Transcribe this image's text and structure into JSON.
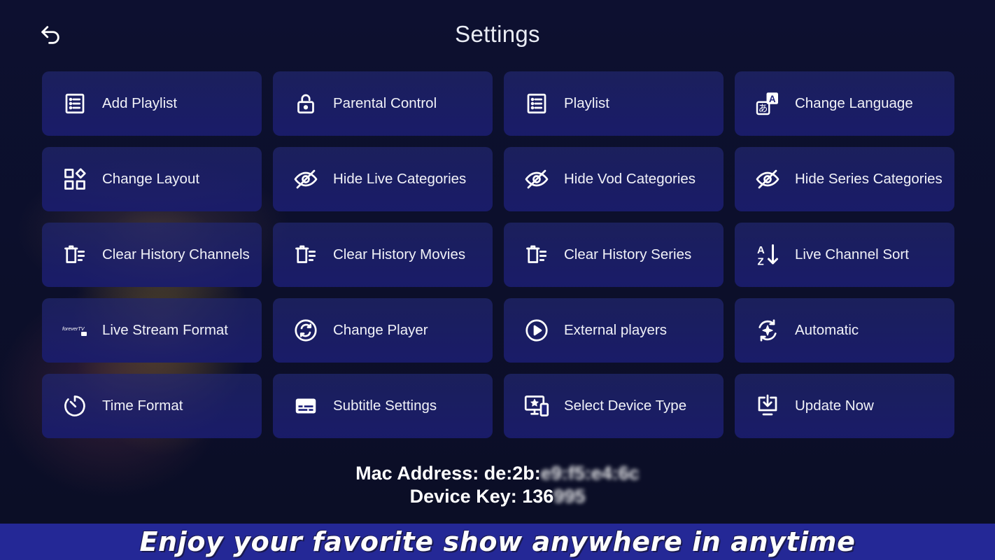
{
  "header": {
    "title": "Settings"
  },
  "tiles": [
    {
      "label": "Add Playlist",
      "icon": "list-icon"
    },
    {
      "label": "Parental Control",
      "icon": "lock-icon"
    },
    {
      "label": "Playlist",
      "icon": "list-icon"
    },
    {
      "label": "Change Language",
      "icon": "translate-icon"
    },
    {
      "label": "Change Layout",
      "icon": "layout-icon"
    },
    {
      "label": "Hide Live Categories",
      "icon": "eye-off-icon"
    },
    {
      "label": "Hide Vod Categories",
      "icon": "eye-off-icon"
    },
    {
      "label": "Hide Series Categories",
      "icon": "eye-off-icon"
    },
    {
      "label": "Clear History Channels",
      "icon": "clear-history-icon"
    },
    {
      "label": "Clear History Movies",
      "icon": "clear-history-icon"
    },
    {
      "label": "Clear History Series",
      "icon": "clear-history-icon"
    },
    {
      "label": "Live Channel Sort",
      "icon": "sort-az-icon"
    },
    {
      "label": "Live Stream Format",
      "icon": "stream-format-icon",
      "icon_text": "foreverTV"
    },
    {
      "label": "Change Player",
      "icon": "change-player-icon"
    },
    {
      "label": "External players",
      "icon": "play-circle-icon"
    },
    {
      "label": "Automatic",
      "icon": "automatic-icon"
    },
    {
      "label": "Time Format",
      "icon": "timer-icon"
    },
    {
      "label": "Subtitle Settings",
      "icon": "subtitles-icon"
    },
    {
      "label": "Select Device Type",
      "icon": "device-icon"
    },
    {
      "label": "Update Now",
      "icon": "update-icon"
    }
  ],
  "device": {
    "mac_label": "Mac Address:",
    "mac_value": "de:2b:",
    "mac_hidden": "e9:f5:e4:6c",
    "key_label": "Device Key:",
    "key_value": "136",
    "key_hidden": "995"
  },
  "banner": {
    "text": "Enjoy your favorite show anywhere in anytime"
  },
  "colors": {
    "background": "#0c0f2a",
    "tile": "#1c1f6e",
    "banner": "#242896"
  }
}
